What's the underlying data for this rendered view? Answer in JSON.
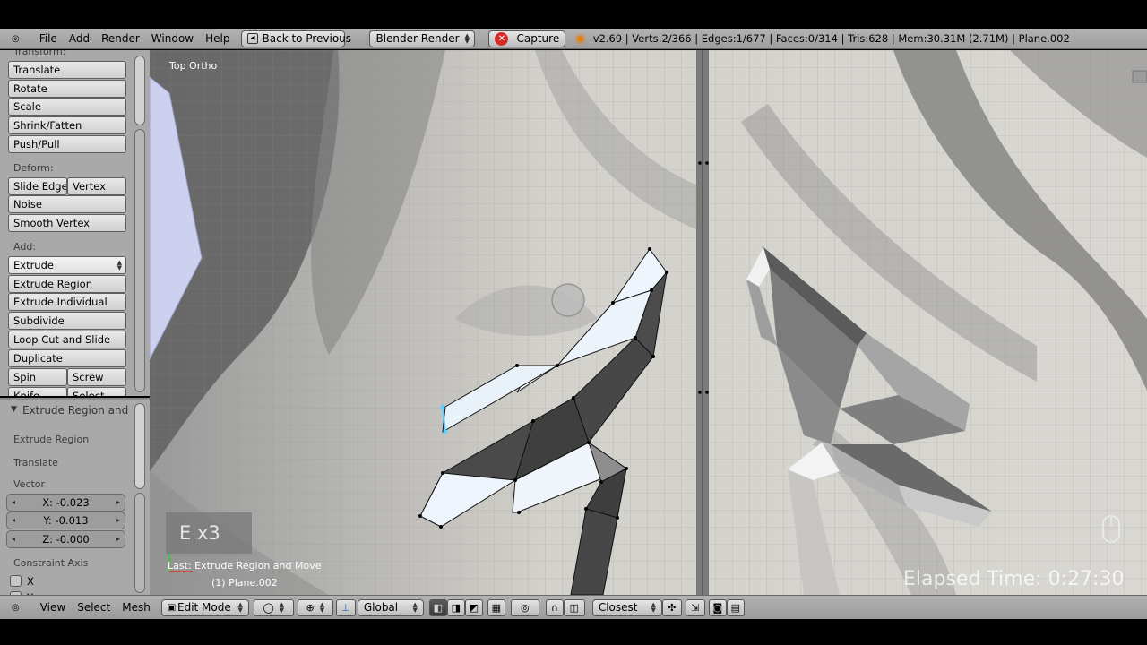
{
  "header": {
    "menu": [
      "File",
      "Add",
      "Render",
      "Window",
      "Help"
    ],
    "back_button": "Back to Previous",
    "render_engine": "Blender Render",
    "capture_button": "Capture",
    "stats": "v2.69 | Verts:2/366 | Edges:1/677 | Faces:0/314 | Tris:628 | Mem:30.31M (2.71M) | Plane.002"
  },
  "tool_shelf": {
    "transform_label": "Transform:",
    "transform": [
      "Translate",
      "Rotate",
      "Scale",
      "Shrink/Fatten",
      "Push/Pull"
    ],
    "deform_label": "Deform:",
    "deform_row": [
      "Slide Edge",
      "Vertex"
    ],
    "deform": [
      "Noise",
      "Smooth Vertex"
    ],
    "add_label": "Add:",
    "extrude_select": "Extrude",
    "add": [
      "Extrude Region",
      "Extrude Individual",
      "Subdivide",
      "Loop Cut and Slide",
      "Duplicate"
    ],
    "spin_row": [
      "Spin",
      "Screw"
    ],
    "knife_row": [
      "Knife",
      "Select"
    ]
  },
  "redo_panel": {
    "title": "Extrude Region and",
    "op1": "Extrude Region",
    "op2": "Translate",
    "vector_label": "Vector",
    "vector": {
      "x": "X: -0.023",
      "y": "Y: -0.013",
      "z": "Z: -0.000"
    },
    "constraint_label": "Constraint Axis",
    "constraint_x": "X",
    "constraint_y": "Y"
  },
  "viewport": {
    "view_name": "Top Ortho",
    "key_overlay": "E x3",
    "last_op": "Last: Extrude Region and Move",
    "object_name": "(1) Plane.002",
    "elapsed": "Elapsed Time: 0:27:30"
  },
  "view_header": {
    "menu": [
      "View",
      "Select",
      "Mesh"
    ],
    "mode": "Edit Mode",
    "orientation": "Global",
    "snap": "Closest"
  },
  "colors": {
    "header_bg": "#a7a7a7",
    "panel_bg": "#a9a9a9",
    "selected_face": "#e9f2fb",
    "mesh_dark": "#4a4a4a",
    "selection_cyan": "#5fd0ff"
  }
}
